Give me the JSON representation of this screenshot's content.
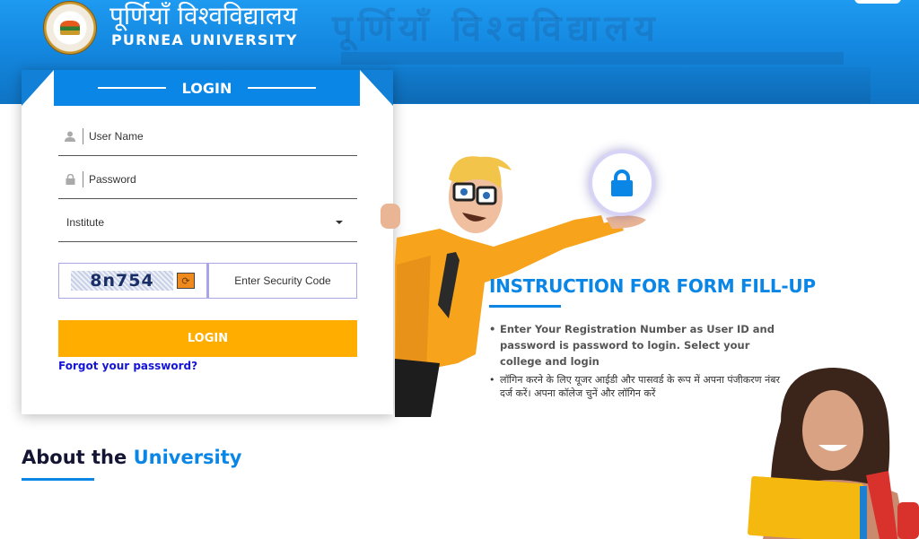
{
  "header": {
    "brand_hindi": "पूर्णियाँ विश्वविद्यालय",
    "brand_english": "PURNEA UNIVERSITY",
    "banner_background_text": "पूर्णियाँ  विश्वविद्यालय",
    "logo_icon": "university-seal-icon"
  },
  "login": {
    "title": "LOGIN",
    "username_placeholder": "User Name",
    "username_icon": "user-icon",
    "password_placeholder": "Password",
    "password_icon": "lock-icon",
    "institute_selected": "Institute",
    "captcha_text": "8n754",
    "captcha_refresh_icon": "refresh-icon",
    "security_code_placeholder": "Enter Security Code",
    "submit_label": "LOGIN",
    "forgot_label": "Forgot your password?"
  },
  "instructions": {
    "title": "INSTRUCTION FOR FORM FILL-UP",
    "items": [
      "Enter Your Registration Number as User ID and password is password to login. Select your college and login",
      "लॉगिन करने के लिए यूजर आईडी और पासवर्ड के रूप में अपना पंजीकरण नंबर दर्ज करें। अपना कॉलेज चुनें और लॉगिन करें"
    ],
    "bullet": "•"
  },
  "about": {
    "title_prefix": "About the ",
    "title_accent": "University"
  },
  "colors": {
    "primary_blue": "#0a86e6",
    "login_button": "#ffae00",
    "forgot_link": "#1515d6",
    "heading_dark": "#141433"
  }
}
